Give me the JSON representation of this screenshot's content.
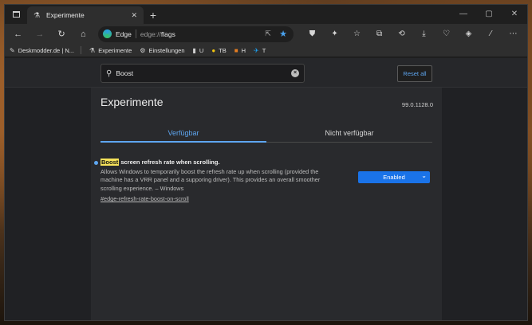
{
  "tab": {
    "title": "Experimente",
    "close": "✕"
  },
  "toolbar": {
    "omnibox_label": "Edge",
    "url_prefix": "edge://",
    "url_path": "flags"
  },
  "favorites": [
    {
      "label": "Deskmodder.de | N...",
      "icon": "pen-icon"
    },
    {
      "label": "Experimente",
      "icon": "flask-icon"
    },
    {
      "label": "Einstellungen",
      "icon": "gear-icon"
    },
    {
      "label": "U",
      "icon": "u-icon"
    },
    {
      "label": "TB",
      "icon": "tb-icon"
    },
    {
      "label": "H",
      "icon": "h-icon"
    },
    {
      "label": "T",
      "icon": "twitter-icon"
    }
  ],
  "search": {
    "value": "Boost"
  },
  "reset_label": "Reset all",
  "page_title": "Experimente",
  "version": "99.0.1128.0",
  "tabs": {
    "available": "Verfügbar",
    "unavailable": "Nicht verfügbar"
  },
  "flag": {
    "highlight": "Boost",
    "name_rest": " screen refresh rate when scrolling.",
    "description": "Allows Windows to temporarily boost the refresh rate up when scrolling (provided the machine has a VRR panel and a supporing driver). This provides an overall smoother scrolling experience. – Windows",
    "link": "#edge-refresh-rate-boost-on-scroll",
    "state": "Enabled"
  },
  "colors": {
    "accent": "#5ea6f0",
    "select_bg": "#1a73e8",
    "highlight": "#f6e25a"
  }
}
